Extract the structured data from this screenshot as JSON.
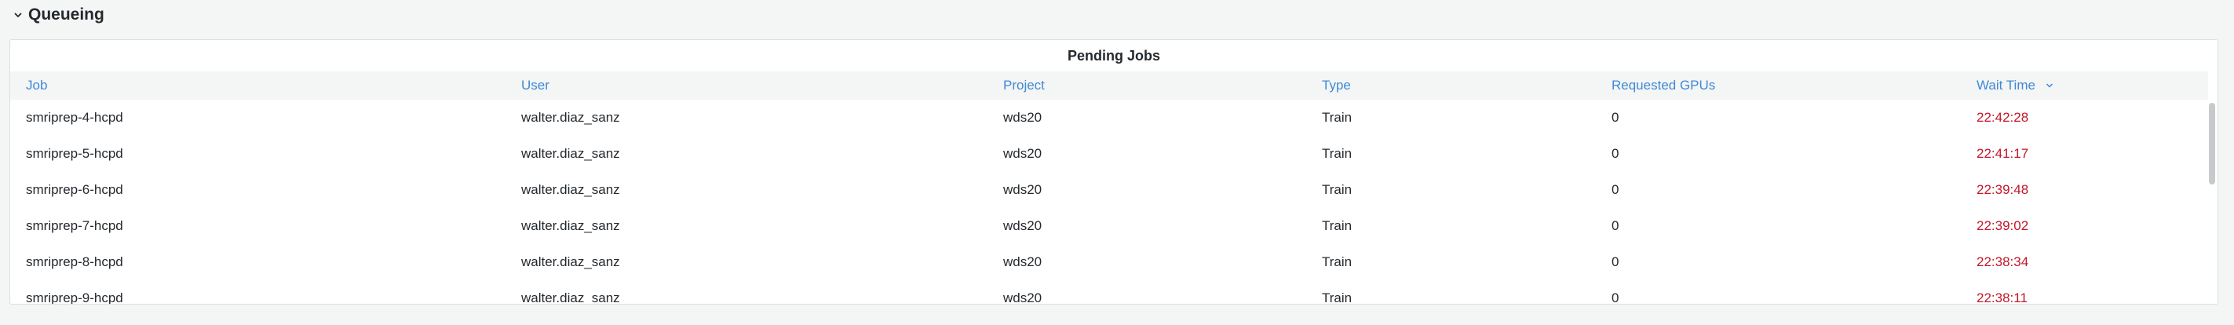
{
  "row": {
    "title": "Queueing",
    "collapse_icon": "chevron-down-icon"
  },
  "panel": {
    "title": "Pending Jobs",
    "columns": [
      "Job",
      "User",
      "Project",
      "Type",
      "Requested GPUs",
      "Wait Time"
    ],
    "sort": {
      "column": "Wait Time",
      "direction": "descending",
      "icon": "chevron-down-icon"
    },
    "rows": [
      [
        "smriprep-4-hcpd",
        "walter.diaz_sanz",
        "wds20",
        "Train",
        "0",
        "22:42:28"
      ],
      [
        "smriprep-5-hcpd",
        "walter.diaz_sanz",
        "wds20",
        "Train",
        "0",
        "22:41:17"
      ],
      [
        "smriprep-6-hcpd",
        "walter.diaz_sanz",
        "wds20",
        "Train",
        "0",
        "22:39:48"
      ],
      [
        "smriprep-7-hcpd",
        "walter.diaz_sanz",
        "wds20",
        "Train",
        "0",
        "22:39:02"
      ],
      [
        "smriprep-8-hcpd",
        "walter.diaz_sanz",
        "wds20",
        "Train",
        "0",
        "22:38:34"
      ],
      [
        "smriprep-9-hcpd",
        "walter.diaz_sanz",
        "wds20",
        "Train",
        "0",
        "22:38:11"
      ]
    ]
  },
  "colors": {
    "header_text": "#3f8ad6",
    "wait_time_text": "#c4162a",
    "header_bg": "#f4f5f5"
  }
}
